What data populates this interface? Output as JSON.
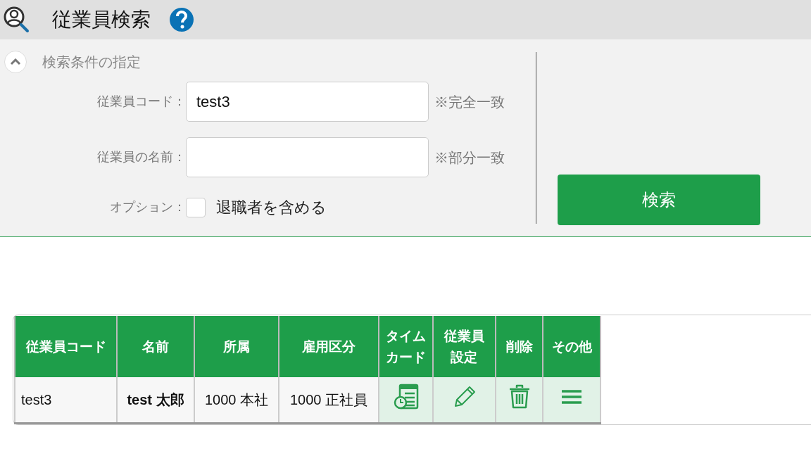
{
  "header": {
    "title": "従業員検索"
  },
  "search_panel": {
    "title": "検索条件の指定",
    "expanded": true,
    "fields": [
      {
        "label": "従業員コード：",
        "value": "test3",
        "note": "※完全一致"
      },
      {
        "label": "従業員の名前：",
        "note": "※部分一致"
      }
    ],
    "option": {
      "label": "オプション：",
      "checkbox_label": "退職者を含める",
      "checked": false
    },
    "search_button": "検索"
  },
  "table": {
    "columns": [
      {
        "label": "従業員コード",
        "kind": "text"
      },
      {
        "label": "名前",
        "kind": "text"
      },
      {
        "label": "所属",
        "kind": "text"
      },
      {
        "label": "雇用区分",
        "kind": "text"
      },
      {
        "label": "タイムカード",
        "kind": "timecard"
      },
      {
        "label": "従業員設定",
        "kind": "edit"
      },
      {
        "label": "削除",
        "kind": "delete"
      },
      {
        "label": "その他",
        "kind": "menu"
      }
    ],
    "rows": [
      {
        "cells": [
          {
            "text": "test3",
            "bold": false
          },
          {
            "text": "test 太郎",
            "bold": true
          },
          {
            "text": "1000 本社",
            "bold": false
          },
          {
            "text": "1000 正社員",
            "bold": false
          }
        ]
      }
    ]
  }
}
